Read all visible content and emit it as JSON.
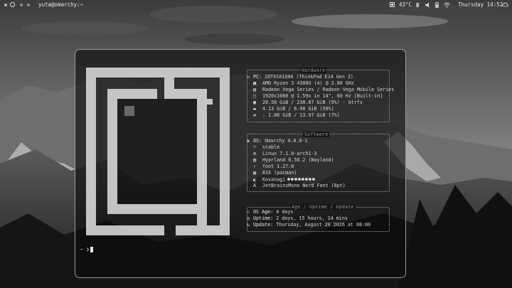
{
  "topbar": {
    "window_title": "yuta@omarchy:~",
    "temperature": "43°C",
    "clock": "Thursday 14:52",
    "icons": [
      "bluetooth-icon",
      "speaker-icon",
      "battery-icon",
      "wifi-icon",
      "cloud-icon"
    ]
  },
  "terminal": {
    "hardware": {
      "title": "Hardware",
      "rows": [
        {
          "icon": "laptop-icon",
          "key": "PC:",
          "value": " 20T6S01Q00 (ThinkPad E14 Gen 2)"
        },
        {
          "icon": "cpu-icon",
          "key": "",
          "value": " AMD Ryzen 3 4300U (4) @ 3.80 GHz"
        },
        {
          "icon": "gpu-icon",
          "key": "",
          "value": " Radeon Vega Series / Radeon Vega Mobile Series"
        },
        {
          "icon": "display-icon",
          "key": "",
          "value": " 1920x1080 @ 1.59x in 14\", 60 Hz [Built-in]"
        },
        {
          "icon": "disk-icon",
          "key": "",
          "value": " 20.58 GiB / 230.87 GiB (9%) - btrfs"
        },
        {
          "icon": "memory-icon",
          "key": "",
          "value": " 4.13 GiB / 6.98 GiB (59%)"
        },
        {
          "icon": "swap-icon",
          "key": "",
          "value": " : 1.00 GiB / 13.97 GiB (7%)"
        }
      ]
    },
    "software": {
      "title": "Software",
      "rows": [
        {
          "icon": "os-icon",
          "key": "OS:",
          "value": " Omarchy 4.0.0-1"
        },
        {
          "icon": "branch-icon",
          "key": "",
          "value": " stable"
        },
        {
          "icon": "kernel-icon",
          "key": "",
          "value": " Linux 7.1.8-arch1-3"
        },
        {
          "icon": "wm-icon",
          "key": "",
          "value": " Hyprland 0.56.2 (Wayland)"
        },
        {
          "icon": "terminal-icon",
          "key": "",
          "value": " foot 1.27.0"
        },
        {
          "icon": "package-icon",
          "key": "",
          "value": " 816 (pacman)"
        },
        {
          "icon": "theme-icon",
          "key": "",
          "value": " Kovanagi"
        },
        {
          "icon": "font-icon",
          "key": "",
          "value": " JetBrainsMono Nerd Font (8pt)"
        }
      ]
    },
    "uptime": {
      "title": "Age / Uptime / Update",
      "rows": [
        {
          "icon": "age-icon",
          "key": "OS Age:",
          "value": " 4 days"
        },
        {
          "icon": "uptime-icon",
          "key": "Uptime:",
          "value": " 2 days, 15 hours, 14 mins"
        },
        {
          "icon": "update-icon",
          "key": "Update:",
          "value": " Thursday, August 20 2026 at 08:00"
        }
      ]
    },
    "prompt": "~ ❯"
  },
  "colors": {
    "terminal_bg": "#0a0a0a",
    "text": "#d6d6d6",
    "logo": "#d4d4d4"
  }
}
